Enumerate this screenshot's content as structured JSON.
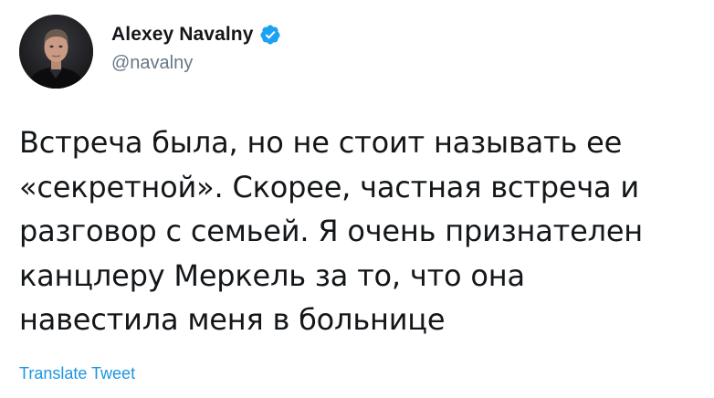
{
  "tweet": {
    "author": {
      "display_name": "Alexey Navalny",
      "handle": "@navalny",
      "verified": true,
      "avatar_icon": "avatar-photo",
      "verified_icon": "verified-badge-icon"
    },
    "text_lines": [
      "Встреча была, но не стоит называть ее",
      "«секретной». Скорее, частная встреча и",
      "разговор с семьей. Я очень признателен",
      "канцлеру Меркель за то, что она",
      "навестила меня в больнице"
    ],
    "translate_label": "Translate Tweet"
  },
  "colors": {
    "text": "#14171a",
    "secondary": "#657786",
    "link": "#1b95e0",
    "verified": "#1da1f2"
  }
}
